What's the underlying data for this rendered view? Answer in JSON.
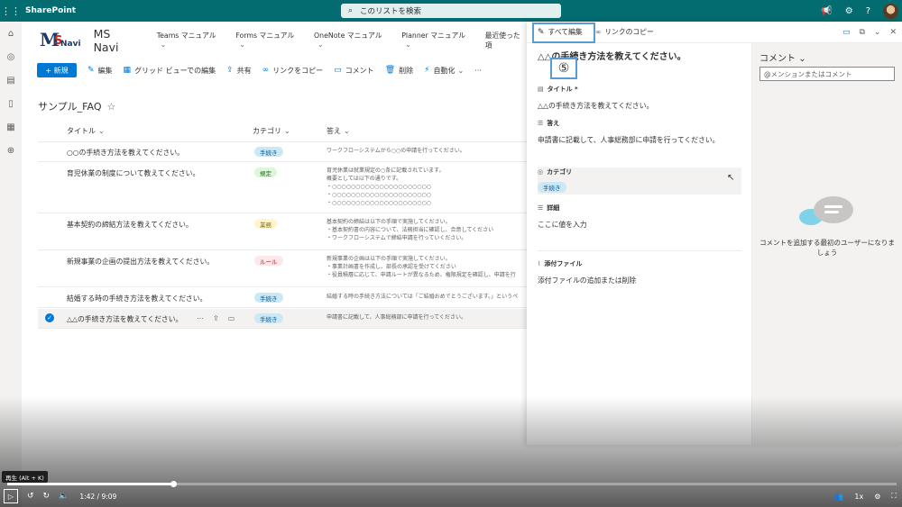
{
  "suitebar": {
    "brand": "SharePoint",
    "search_placeholder": "このリストを検索",
    "icons": [
      "megaphone-icon",
      "gear-icon",
      "help-icon"
    ]
  },
  "site": {
    "logo_m": "M",
    "logo_s": "S",
    "logo_n": "Navi",
    "title": "MS Navi",
    "nav": [
      "Teams マニュアル",
      "Forms マニュアル",
      "OneNote マニュアル",
      "Planner マニュアル",
      "最近使った項"
    ]
  },
  "commandbar": {
    "new": "+ 新規",
    "edit": "編集",
    "grid": "グリッド ビューでの編集",
    "share": "共有",
    "copylink": "リンクをコピー",
    "comment": "コメント",
    "delete": "削除",
    "automate": "自動化",
    "more": "···"
  },
  "list": {
    "title": "サンプル_FAQ",
    "columns": {
      "title": "タイトル",
      "category": "カテゴリ",
      "answer": "答え"
    },
    "rows": [
      {
        "title": "○○の手続き方法を教えてください。",
        "category": "手続き",
        "answer": [
          "ワークフローシステムから○○の申請を行ってください。"
        ]
      },
      {
        "title": "育児休業の制度について教えてください。",
        "category": "規定",
        "answer": [
          "育児休業は就業規定の○条に記載されています。",
          "概要としては以下の通りです。",
          "・○○○○○○○○○○○○○○○○○○○○○",
          "・○○○○○○○○○○○○○○○○○○○○○",
          "・○○○○○○○○○○○○○○○○○○○○○"
        ]
      },
      {
        "title": "基本契約の締結方法を教えてください。",
        "category": "業務",
        "answer": [
          "基本契約の締結は以下の手順で実施してください。",
          "・基本契約書の内容について、法務担当に確認し、合意してください",
          "・ワークフローシステムで締結申請を行っていください。"
        ]
      },
      {
        "title": "新規事業の企画の提出方法を教えてください。",
        "category": "ルール",
        "answer": [
          "新規事業の企画は以下の手順で実施してください。",
          "・事業計画書を作成し、部長の承認を受けてください",
          "・役員積層に応じて、申請ルートが異なるため、権限規定を確認し、申請を行"
        ]
      },
      {
        "title": "結婚する時の手続き方法を教えてください。",
        "category": "手続き",
        "answer": [
          "結婚する時の手続き方法については「ご結婚おめでとうございます。」というペ"
        ]
      },
      {
        "title": "△△の手続き方法を教えてください。",
        "category": "手続き",
        "answer": [
          "申請書に記載して、人事総務部に申請を行ってください。"
        ]
      }
    ]
  },
  "panel": {
    "edit_all": "すべて編集",
    "copy_link": "リンクのコピー",
    "step_marker": "⑤",
    "item_title": "△△の手続き方法を教えてください。",
    "fields": {
      "title_label": "タイトル *",
      "title_value": "△△の手続き方法を教えてください。",
      "answer_label": "答え",
      "answer_value": "申請書に記載して、人事総務部に申請を行ってください。",
      "category_label": "カテゴリ",
      "category_value": "手続き",
      "detail_label": "詳細",
      "detail_value": "ここに値を入力",
      "attach_label": "添付ファイル",
      "attach_value": "添付ファイルの追加または削除"
    },
    "comments": {
      "header": "コメント",
      "input_placeholder": "@メンションまたはコメント",
      "empty": "コメントを追加する最初のユーザーになりましょう"
    }
  },
  "video": {
    "tooltip": "再生 (Alt + K)",
    "timecode": "1:42 / 9:09",
    "progress_fraction": 0.187,
    "speed": "1x"
  },
  "colors": {
    "suitebar": "#036c70",
    "accent": "#0078d4",
    "highlight": "#5b9bd5"
  }
}
